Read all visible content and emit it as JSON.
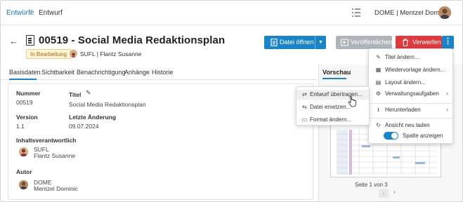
{
  "breadcrumb": {
    "root": "Entwürfe",
    "sep": "/",
    "current": "Entwurf"
  },
  "user": {
    "label": "DOME | Mentzel Dominic",
    "tasks_icon": "task-list-icon"
  },
  "header": {
    "title": "00519 - Social Media Redaktionsplan",
    "status": "In Bearbeitung",
    "owner": "SUFL | Flantz Susanne"
  },
  "actions": {
    "open": "Datei öffnen",
    "publish": "Veröffentlichen",
    "discard": "Verwerfen",
    "more": "⋮"
  },
  "tabs": [
    "Basisdaten",
    "Sichtbarkeit",
    "Benachrichtigung",
    "Anhänge",
    "Historie"
  ],
  "fields": {
    "nummer_label": "Nummer",
    "nummer_value": "00519",
    "titel_label": "Titel",
    "titel_value": "Social Media Redaktionsplan",
    "version_label": "Version",
    "version_value": "1.1",
    "aenderung_label": "Letzte Änderung",
    "aenderung_value": "09.07.2024",
    "verantw_label": "Inhaltsverantwortlich",
    "verantw_code": "SUFL",
    "verantw_name": "Flantz Susanne",
    "autor_label": "Autor",
    "autor_code": "DOME",
    "autor_name": "Mentzel Dominic"
  },
  "preview": {
    "tab": "Vorschau",
    "page_info": "Seite 1 von 3",
    "prev": "‹",
    "next": "›"
  },
  "menu": {
    "items": [
      {
        "label": "Titel ändern...",
        "icon": "pencil-icon"
      },
      {
        "label": "Wiedervorlage ändern...",
        "icon": "calendar-icon"
      },
      {
        "label": "Layout ändern...",
        "icon": "layout-icon"
      },
      {
        "label": "Verwaltungsaufgaben",
        "icon": "gear-icon",
        "submenu": true
      },
      {
        "label": "Herunterladen",
        "icon": "download-icon",
        "submenu": true
      },
      {
        "label": "Ansicht neu laden",
        "icon": "refresh-icon"
      }
    ],
    "toggle_label": "Spalte anzeigen",
    "toggle_on": true
  },
  "submenu": {
    "items": [
      {
        "label": "Entwurf übertragen...",
        "icon": "transfer-icon"
      },
      {
        "label": "Datei ersetzen...",
        "icon": "swap-icon"
      },
      {
        "label": "Format ändern...",
        "icon": "file-icon"
      }
    ]
  },
  "colors": {
    "primary": "#1a84c7",
    "danger": "#e0393e",
    "muted": "#aeb4ba",
    "badge": "#fff4dc"
  }
}
